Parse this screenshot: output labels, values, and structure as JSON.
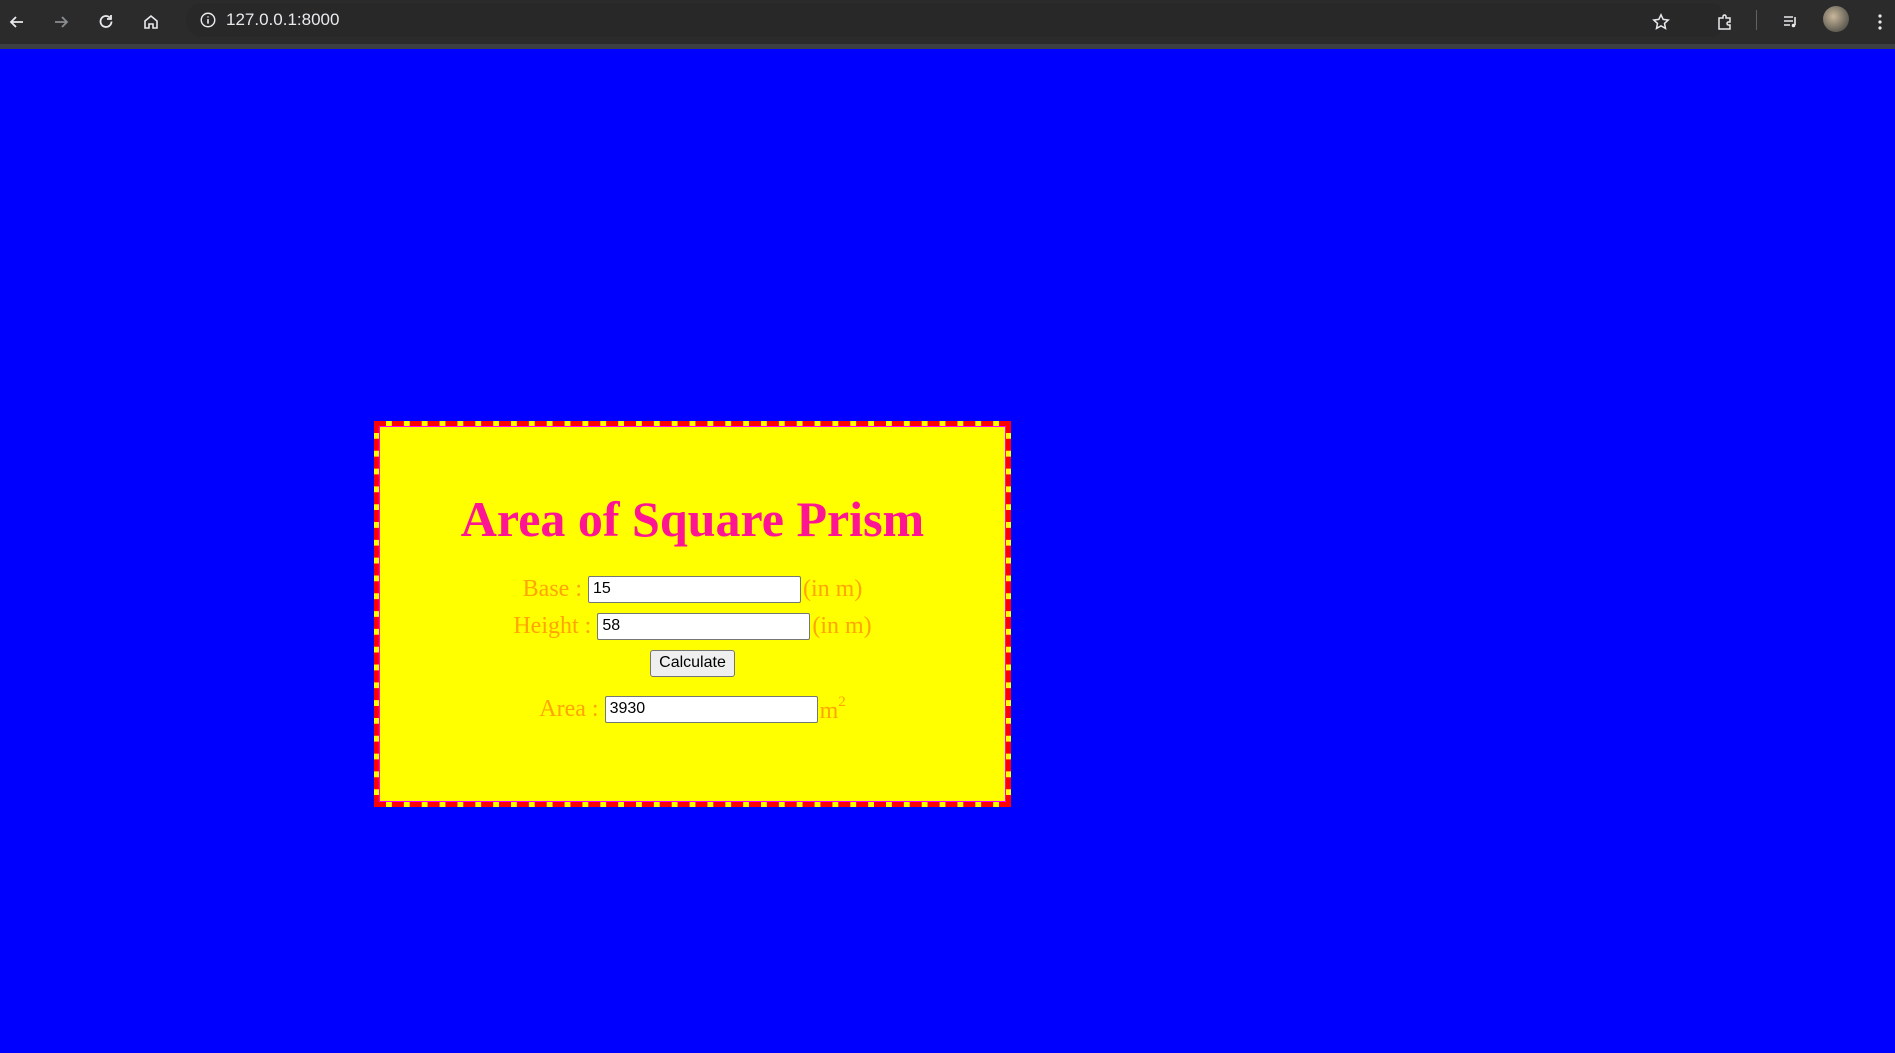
{
  "browser": {
    "url": "127.0.0.1:8000",
    "icons": [
      "back-icon",
      "forward-icon",
      "reload-icon",
      "home-icon",
      "info-icon",
      "star-icon",
      "extensions-icon",
      "media-icon",
      "profile-avatar",
      "menu-icon"
    ]
  },
  "page": {
    "background_color": "#0000ff",
    "card": {
      "background_color": "#ffff00",
      "border_color": "#ff0000",
      "title": "Area of Square Prism",
      "title_color": "#ff1493",
      "label_color": "#ffa500",
      "base": {
        "label": "Base :",
        "value": "15",
        "unit": "(in m)"
      },
      "height": {
        "label": "Height :",
        "value": "58",
        "unit": "(in m)"
      },
      "calculate_button": "Calculate",
      "area": {
        "label": "Area :",
        "value": "3930",
        "unit": "m",
        "unit_sup": "2"
      }
    }
  }
}
